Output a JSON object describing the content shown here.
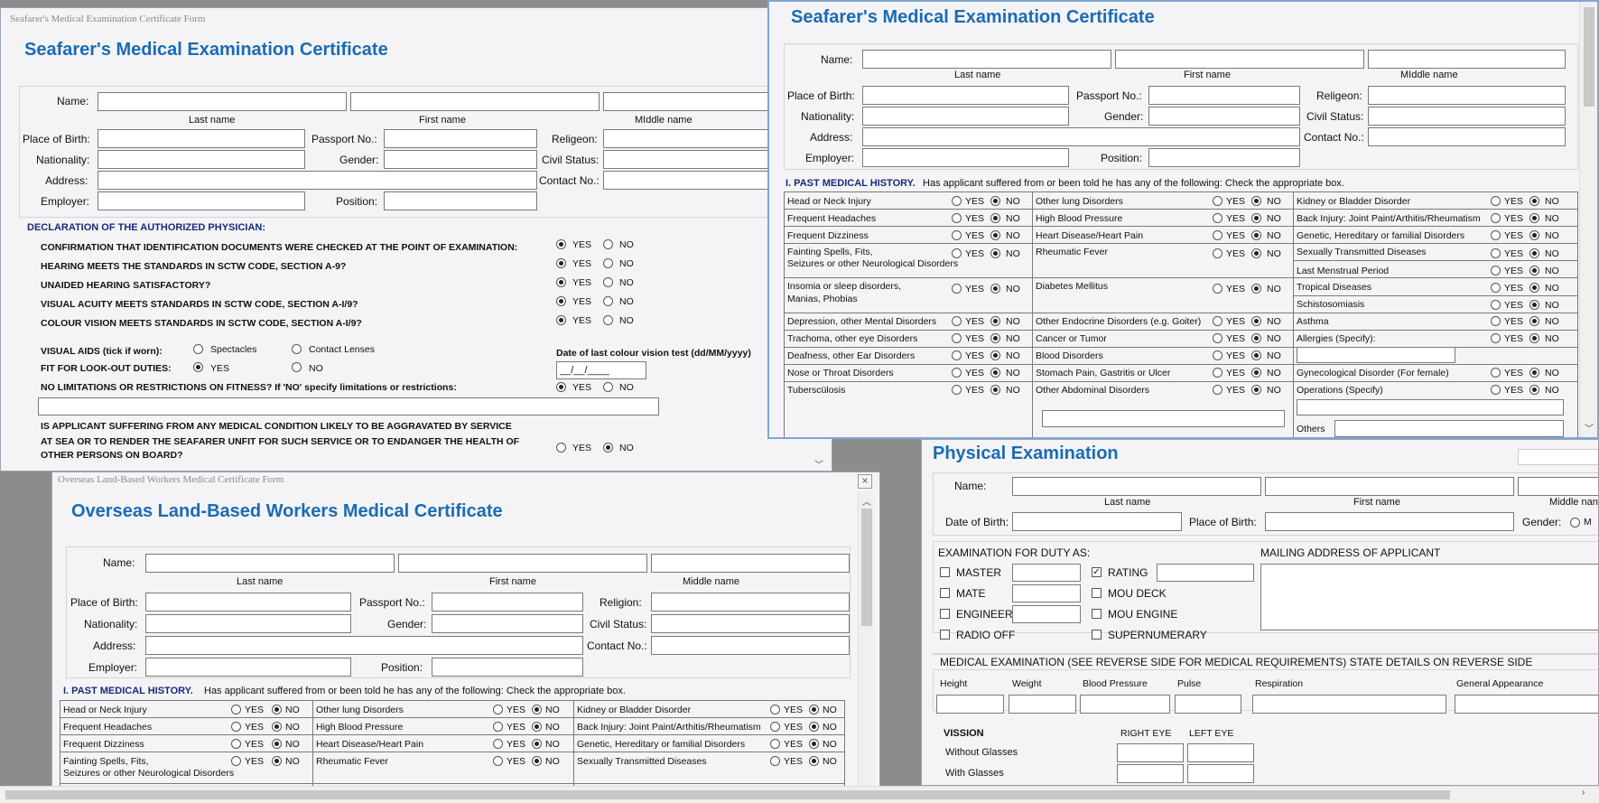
{
  "form_labels": {
    "name": "Name:",
    "last_name": "Last name",
    "first_name": "First name",
    "middle_name": "Middle name",
    "middle_name_alt": "MIddle name",
    "middle_name_clip": "Middle nan",
    "place_of_birth": "Place of Birth:",
    "passport": "Passport No.:",
    "religion": "Religeon:",
    "religion_alt": "Religion:",
    "nationality": "Nationality:",
    "gender": "Gender:",
    "civil_status": "Civil Status:",
    "address": "Address:",
    "contact": "Contact No.:",
    "employer": "Employer:",
    "position": "Position:",
    "yes": "YES",
    "no": "NO"
  },
  "win1": {
    "window_title": "Seafarer's Medical Examination Certificate Form",
    "heading": "Seafarer's Medical Examination Certificate",
    "declaration_title": "DECLARATION OF THE AUTHORIZED PHYSICIAN:",
    "declarations": [
      "CONFIRMATION THAT IDENTIFICATION DOCUMENTS WERE CHECKED AT THE POINT OF EXAMINATION:",
      "HEARING MEETS THE STANDARDS IN SCTW CODE, SECTION A-9?",
      "UNAIDED HEARING SATISFACTORY?",
      "VISUAL ACUITY MEETS STANDARDS IN SCTW CODE, SECTION A-I/9?",
      "COLOUR VISION MEETS STANDARDS IN SCTW CODE, SECTION A-I/9?"
    ],
    "visual_aids_label": "VISUAL AIDS (tick if worn):",
    "spectacles": "Spectacles",
    "contact_lenses": "Contact Lenses",
    "date_colour_label": "Date of last colour vision test (dd/MM/yyyy)",
    "date_value": "__/__/____",
    "fit_lookout": "FIT FOR LOOK-OUT DUTIES:",
    "no_limitations": "NO LIMITATIONS OR RESTRICTIONS ON FITNESS? If 'NO' specify limitations or restrictions:",
    "aggravated_1": "IS APPLICANT SUFFERING FROM ANY MEDICAL CONDITION LIKELY TO BE AGGRAVATED BY SERVICE",
    "aggravated_2": "AT SEA OR TO  RENDER THE SEAFARER UNFIT FOR SUCH SERVICE OR TO ENDANGER THE HEALTH OF",
    "aggravated_3": "OTHER PERSONS ON BOARD?"
  },
  "win2": {
    "heading": "Seafarer's Medical Examination Certificate",
    "history_title": "I.  PAST MEDICAL HISTORY.",
    "history_desc": "Has applicant suffered from or been told he has any of the following: Check the appropriate box.",
    "col1": [
      "Head or Neck Injury",
      "Frequent Headaches",
      "Frequent Dizziness",
      "Fainting Spells, Fits,",
      "Seizures or other Neurological Disorders",
      "Insomia or sleep disorders,",
      "Manias, Phobias",
      "Depression, other Mental Disorders",
      "Trachoma, other eye Disorders",
      "Deafness, other Ear Disorders",
      "Nose or Throat Disorders",
      "Tuberscülosis"
    ],
    "col2": [
      "Other lung Disorders",
      "High Blood Pressure",
      "Heart Disease/Heart Pain",
      "Rheumatic Fever",
      "Diabetes Mellitus",
      "Other Endocrine Disorders (e.g. Goiter)",
      "Cancer or Tumor",
      "Blood Disorders",
      "Stomach Pain, Gastritis or Ulcer",
      "Other Abdominal Disorders"
    ],
    "col3": [
      "Kidney or Bladder Disorder",
      "Back Injury: Joint Paint/Arthitis/Rheumatism",
      "Genetic, Hereditary or familial Disorders",
      "Sexually Transmitted Diseases",
      "Last Menstrual Period",
      "Tropical Diseases",
      "Schistosomiasis",
      "Asthma",
      "Allergies (Specify):",
      "Gynecological Disorder (For female)",
      "Operations (Specify)",
      "Others"
    ]
  },
  "win3": {
    "window_title": "Overseas Land-Based Workers Medical Certificate Form",
    "heading": "Overseas Land-Based Workers Medical Certificate",
    "close": "×"
  },
  "win4": {
    "heading": "Physical Examination",
    "dob": "Date of Birth:",
    "exam_duty": "EXAMINATION FOR DUTY AS:",
    "duties_left": [
      "MASTER",
      "MATE",
      "ENGINEER",
      "RADIO OFF"
    ],
    "duties_right": [
      "RATING",
      "MOU DECK",
      "MOU ENGINE",
      "SUPERNUMERARY"
    ],
    "mailing": "MAILING ADDRESS OF APPLICANT",
    "med_exam": "MEDICAL EXAMINATION (SEE REVERSE SIDE FOR MEDICAL REQUIREMENTS) STATE DETAILS ON REVERSE SIDE",
    "measures": [
      "Height",
      "Weight",
      "Blood Pressure",
      "Pulse",
      "Respiration",
      "General Appearance"
    ],
    "vision": "VISSION",
    "right_eye": "RIGHT EYE",
    "left_eye": "LEFT EYE",
    "without_glasses": "Without Glasses",
    "with_glasses": "With Glasses",
    "gender_option": "M"
  },
  "colors": {
    "heading": "#1b6bb5",
    "section": "#1a2a7a",
    "background": "#8c8c8c"
  }
}
